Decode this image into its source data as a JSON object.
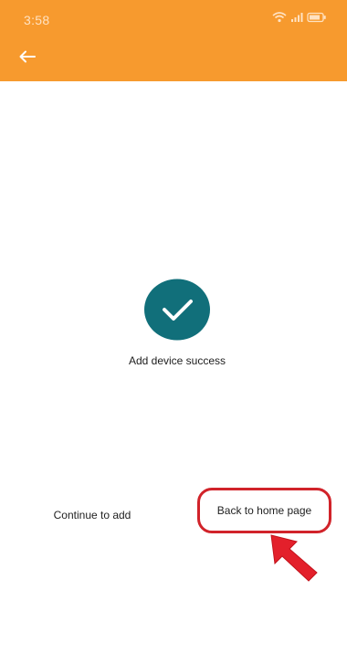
{
  "status_bar": {
    "time": "3:58",
    "icons": [
      "wifi-icon",
      "signal-icon",
      "battery-icon"
    ]
  },
  "header": {
    "back_icon": "back-arrow-icon"
  },
  "main": {
    "success_icon": "check-circle-icon",
    "success_message": "Add device success",
    "continue_label": "Continue to add",
    "home_label": "Back to home page"
  },
  "annotation": {
    "pointer_icon": "red-arrow-pointer-icon"
  },
  "colors": {
    "app_bar": "#f79a2e",
    "success": "#116f7a",
    "highlight": "#d1232a",
    "background": "#ffffff"
  }
}
